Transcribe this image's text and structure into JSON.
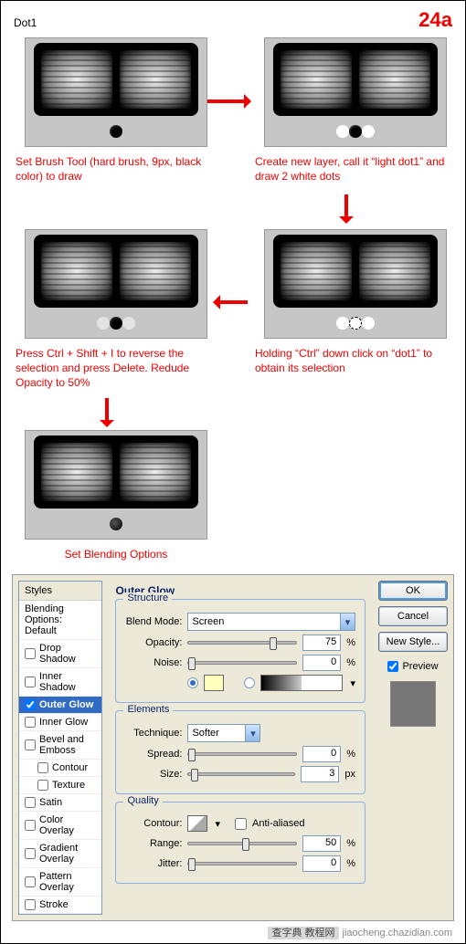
{
  "header": {
    "title": "Dot1",
    "step": "24a"
  },
  "flow": {
    "c1": {
      "caption": "Set Brush Tool (hard brush, 9px, black color) to draw"
    },
    "c2": {
      "caption": "Create new layer, call it “light dot1” and draw 2 white dots"
    },
    "c3": {
      "caption": "Holding “Ctrl” down click on “dot1” to obtain its selection"
    },
    "c4": {
      "caption": "Press Ctrl + Shift + I to reverse the selection and press Delete. Redude Opacity to 50%"
    },
    "c5": {
      "caption": "Set Blending Options"
    }
  },
  "styles": {
    "header": "Styles",
    "blending": "Blending Options: Default",
    "items": {
      "dropShadow": "Drop Shadow",
      "innerShadow": "Inner Shadow",
      "outerGlow": "Outer Glow",
      "innerGlow": "Inner Glow",
      "bevel": "Bevel and Emboss",
      "contour": "Contour",
      "texture": "Texture",
      "satin": "Satin",
      "colorOverlay": "Color Overlay",
      "gradientOverlay": "Gradient Overlay",
      "patternOverlay": "Pattern Overlay",
      "stroke": "Stroke"
    }
  },
  "outerGlow": {
    "title": "Outer Glow",
    "structure": {
      "legend": "Structure",
      "blendMode": {
        "label": "Blend Mode:",
        "value": "Screen"
      },
      "opacity": {
        "label": "Opacity:",
        "value": "75",
        "unit": "%"
      },
      "noise": {
        "label": "Noise:",
        "value": "0",
        "unit": "%"
      }
    },
    "elements": {
      "legend": "Elements",
      "technique": {
        "label": "Technique:",
        "value": "Softer"
      },
      "spread": {
        "label": "Spread:",
        "value": "0",
        "unit": "%"
      },
      "size": {
        "label": "Size:",
        "value": "3",
        "unit": "px"
      }
    },
    "quality": {
      "legend": "Quality",
      "contour": "Contour:",
      "antialiased": "Anti-aliased",
      "range": {
        "label": "Range:",
        "value": "50",
        "unit": "%"
      },
      "jitter": {
        "label": "Jitter:",
        "value": "0",
        "unit": "%"
      }
    }
  },
  "buttons": {
    "ok": "OK",
    "cancel": "Cancel",
    "newStyle": "New Style...",
    "preview": "Preview"
  },
  "watermark": {
    "cn": "查字典 教程网",
    "url": "jiaocheng.chazidian.com"
  }
}
